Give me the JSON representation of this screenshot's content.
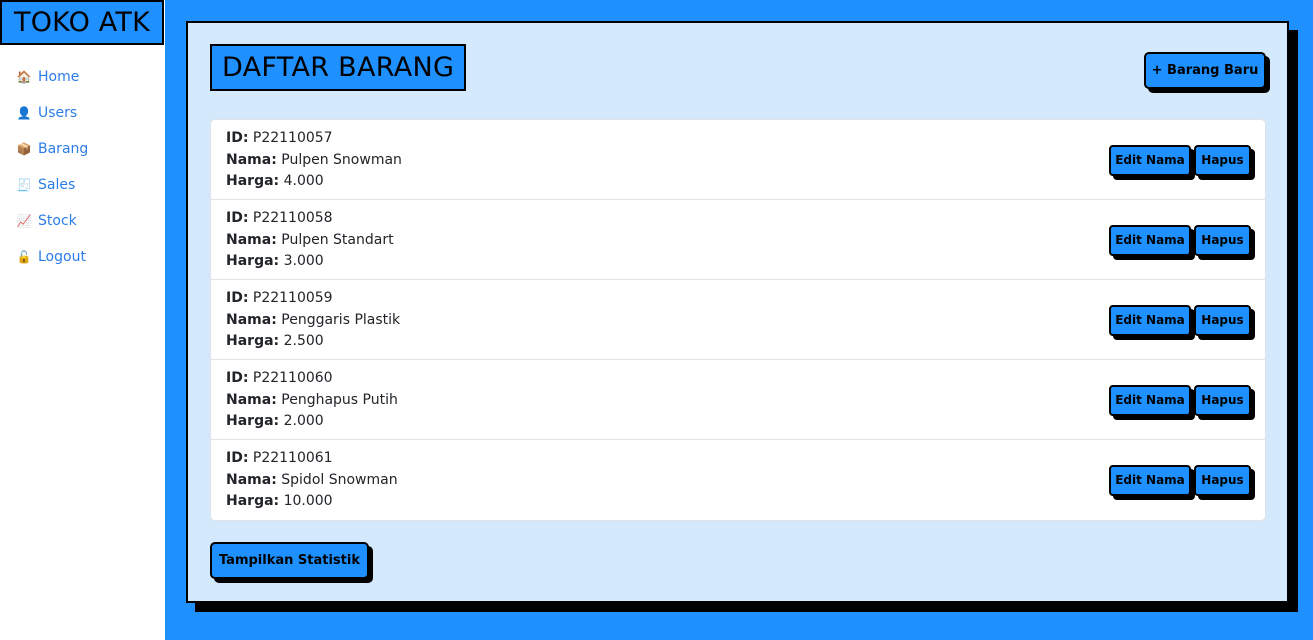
{
  "brand": "TOKO ATK",
  "nav": [
    {
      "label": "Home",
      "icon": "🏠",
      "icon_name": "home-icon"
    },
    {
      "label": "Users",
      "icon": "👤",
      "icon_name": "user-icon"
    },
    {
      "label": "Barang",
      "icon": "📦",
      "icon_name": "package-icon"
    },
    {
      "label": "Sales",
      "icon": "🧾",
      "icon_name": "receipt-icon"
    },
    {
      "label": "Stock",
      "icon": "📈",
      "icon_name": "chart-icon"
    },
    {
      "label": "Logout",
      "icon": "🔓",
      "icon_name": "unlock-icon"
    }
  ],
  "page": {
    "title": "DAFTAR BARANG",
    "new_button": "+ Barang Baru",
    "stats_button": "Tampilkan Statistik"
  },
  "labels": {
    "id": "ID:",
    "nama": "Nama:",
    "harga": "Harga:",
    "edit": "Edit Nama",
    "hapus": "Hapus"
  },
  "items": [
    {
      "id": "P22110057",
      "nama": "Pulpen Snowman",
      "harga": "4.000"
    },
    {
      "id": "P22110058",
      "nama": "Pulpen Standart",
      "harga": "3.000"
    },
    {
      "id": "P22110059",
      "nama": "Penggaris Plastik",
      "harga": "2.500"
    },
    {
      "id": "P22110060",
      "nama": "Penghapus Putih",
      "harga": "2.000"
    },
    {
      "id": "P22110061",
      "nama": "Spidol Snowman",
      "harga": "10.000"
    }
  ],
  "colors": {
    "accent": "#1e90ff",
    "panel": "#d4e9fc",
    "link": "#2b7de9"
  }
}
